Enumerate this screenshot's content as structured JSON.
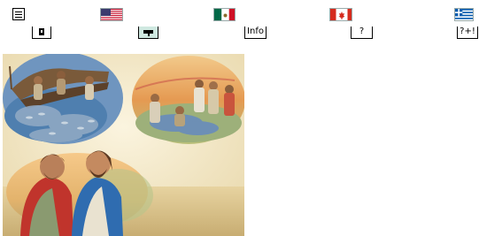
{
  "toolbar": {
    "menu_icon": "hamburger-menu-icon",
    "languages": [
      {
        "name": "flag-us-icon"
      },
      {
        "name": "flag-mexico-icon"
      },
      {
        "name": "flag-canada-icon"
      },
      {
        "name": "flag-greece-icon"
      }
    ],
    "buttons": {
      "print_icon": "print-icon",
      "board_icon": "teacher-board-icon",
      "info_label": "Info",
      "help_label": "?",
      "quiz_label": "?+!"
    }
  },
  "colors": {
    "sea": "#5a86b8",
    "sky": "#e8b77a",
    "background": "#f3ead0",
    "robe_blue": "#2f6cb0",
    "robe_red": "#c0342c"
  }
}
